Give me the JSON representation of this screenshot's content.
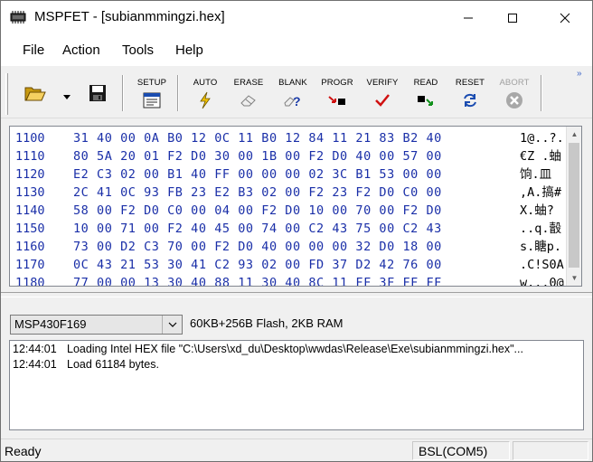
{
  "window": {
    "title": "MSPFET - [subianmmingzi.hex]"
  },
  "menu": [
    "File",
    "Action",
    "Tools",
    "Help"
  ],
  "toolbar": {
    "open_icon": "folder-open-icon",
    "save_icon": "floppy-disk-icon",
    "buttons": [
      {
        "label": "SETUP",
        "icon": "setup-icon"
      },
      {
        "label": "AUTO",
        "icon": "lightning-icon"
      },
      {
        "label": "ERASE",
        "icon": "eraser-icon"
      },
      {
        "label": "BLANK",
        "icon": "blank-check-icon"
      },
      {
        "label": "PROGR",
        "icon": "program-icon"
      },
      {
        "label": "VERIFY",
        "icon": "checkmark-icon"
      },
      {
        "label": "READ",
        "icon": "read-icon"
      },
      {
        "label": "RESET",
        "icon": "reset-icon"
      },
      {
        "label": "ABORT",
        "icon": "abort-icon"
      }
    ],
    "overflow": "»"
  },
  "hex": {
    "rows": [
      {
        "addr": "1100",
        "bytes": "31 40 00 0A B0 12 0C 11 B0 12 84 11 21 83 B2 40",
        "ascii": "1@..?."
      },
      {
        "addr": "1110",
        "bytes": "80 5A 20 01 F2 D0 30 00 1B 00 F2 D0 40 00 57 00",
        "ascii": "€Z .蚰"
      },
      {
        "addr": "1120",
        "bytes": "E2 C3 02 00 B1 40 FF 00 00 00 02 3C B1 53 00 00",
        "ascii": "饷.皿"
      },
      {
        "addr": "1130",
        "bytes": "2C 41 0C 93 FB 23 E2 B3 02 00 F2 23 F2 D0 C0 00",
        "ascii": ",A.搞#"
      },
      {
        "addr": "1140",
        "bytes": "58 00 F2 D0 C0 00 04 00 F2 D0 10 00 70 00 F2 D0",
        "ascii": "X.蚰?"
      },
      {
        "addr": "1150",
        "bytes": "10 00 71 00 F2 40 45 00 74 00 C2 43 75 00 C2 43",
        "ascii": "..q.瞉"
      },
      {
        "addr": "1160",
        "bytes": "73 00 D2 C3 70 00 F2 D0 40 00 00 00 32 D0 18 00",
        "ascii": "s.瞊p."
      },
      {
        "addr": "1170",
        "bytes": "0C 43 21 53 30 41 C2 93 02 00 FD 37 D2 42 76 00",
        "ascii": ".C!S0A"
      },
      {
        "addr": "1180",
        "bytes": "77 00 00 13 30 40 88 11 30 40 8C 11 FF 3F FF FF",
        "ascii": "w...0@"
      }
    ]
  },
  "device": {
    "selected": "MSP430F169",
    "description": "60KB+256B Flash, 2KB RAM"
  },
  "log": [
    {
      "time": "12:44:01",
      "message": "Loading Intel HEX file \"C:\\Users\\xd_du\\Desktop\\wwdas\\Release\\Exe\\subianmmingzi.hex\"..."
    },
    {
      "time": "12:44:01",
      "message": "Load 61184 bytes."
    }
  ],
  "status": {
    "text": "Ready",
    "connection": "BSL(COM5)"
  }
}
